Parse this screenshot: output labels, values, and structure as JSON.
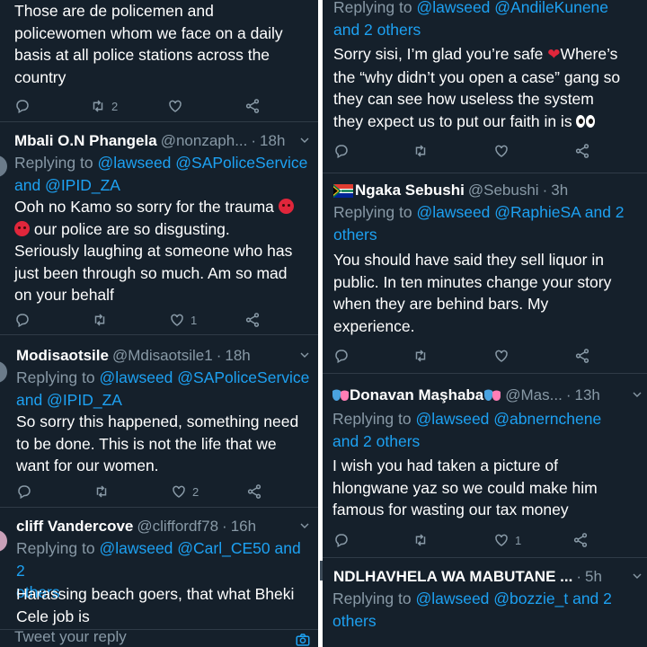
{
  "left": {
    "tweet0": {
      "body_lines": [
        "Those are de policemen and",
        "policewomen whom we face on a daily",
        "basis at all police stations across the",
        "country"
      ],
      "retweets": "2",
      "likes": ""
    },
    "tweet1": {
      "name": "Mbali O.N Phangela",
      "handle": "@nonzaph...",
      "time": "18h",
      "reply_prefix": "Replying to",
      "reply_line1": "@lawseed @SAPoliceService",
      "reply_line2": "and @IPID_ZA",
      "body_line1": "Ooh no Kamo so sorry for the trauma",
      "body_line2": "our police are so disgusting.",
      "body_line3": "Seriously laughing at someone who has",
      "body_line4": "just been through so much. Am so mad",
      "body_line5": "on your behalf",
      "likes": "1"
    },
    "tweet2": {
      "name": "Modisaotsile",
      "handle": "@Mdisaotsile1",
      "time": "18h",
      "reply_prefix": "Replying to",
      "reply_line1": "@lawseed @SAPoliceService",
      "reply_line2": "and @IPID_ZA",
      "body_lines": [
        "So sorry this happened, something need",
        "to be done. This is not the life that we",
        "want for our women."
      ],
      "likes": "2"
    },
    "tweet3": {
      "name": "cliff Vandercove",
      "handle": "@cliffordf78",
      "time": "16h",
      "reply_prefix": "Replying to",
      "reply_links": "@lawseed @Carl_CE50",
      "reply_and": "and 2",
      "reply_line2": "others",
      "body_lines": [
        "Harassing beach goers, that what Bheki",
        "Cele job is"
      ]
    },
    "compose_placeholder": "Tweet your reply"
  },
  "right": {
    "tweet0": {
      "reply_prefix": "Replying to",
      "reply_line1": "@lawseed @AndileKunene",
      "reply_line2": "and 2 others",
      "body_line1a": "Sorry sisi, I’m glad you’re safe",
      "body_line1b": "Where’s",
      "body_line2": "the “why didn’t you open a case” gang so",
      "body_line3": "they can see how useless the system",
      "body_line4": "they expect us to put our faith in is"
    },
    "tweet1": {
      "name": "Ngaka Sebushi",
      "handle": "@Sebushi",
      "time": "3h",
      "reply_prefix": "Replying to",
      "reply_links": "@lawseed @RaphieSA",
      "reply_and": "and 2",
      "reply_line2": "others",
      "body_lines": [
        "You should have said they sell liquor in",
        "public. In ten minutes change your story",
        "when they are behind bars. My",
        "experience."
      ]
    },
    "tweet2": {
      "name": "Donavan Maşhaba",
      "handle": "@Mas...",
      "time": "13h",
      "reply_prefix": "Replying to",
      "reply_line1": "@lawseed @abnernchene",
      "reply_line2": "and 2 others",
      "body_lines": [
        "I wish you had taken a picture of",
        "hlongwane yaz so we could make him",
        "famous for wasting our tax money"
      ],
      "likes": "1"
    },
    "tweet3": {
      "name": "NDLHAVHELA WA MABUTANE ...",
      "time": "5h",
      "reply_prefix": "Replying to",
      "reply_links": "@lawseed @bozzie_t",
      "reply_and": "and 2",
      "reply_line2": "others"
    }
  },
  "colors": {
    "background": "#15202b",
    "link": "#1da1f2",
    "muted": "#8899a6",
    "divider": "#2f3b47"
  },
  "icons": [
    "reply-icon",
    "retweet-icon",
    "like-icon",
    "share-icon",
    "chevron-down-icon",
    "angry-face-emoji",
    "red-heart-emoji",
    "eyes-emoji",
    "south-africa-flag-emoji",
    "performing-arts-emoji",
    "camera-icon"
  ]
}
